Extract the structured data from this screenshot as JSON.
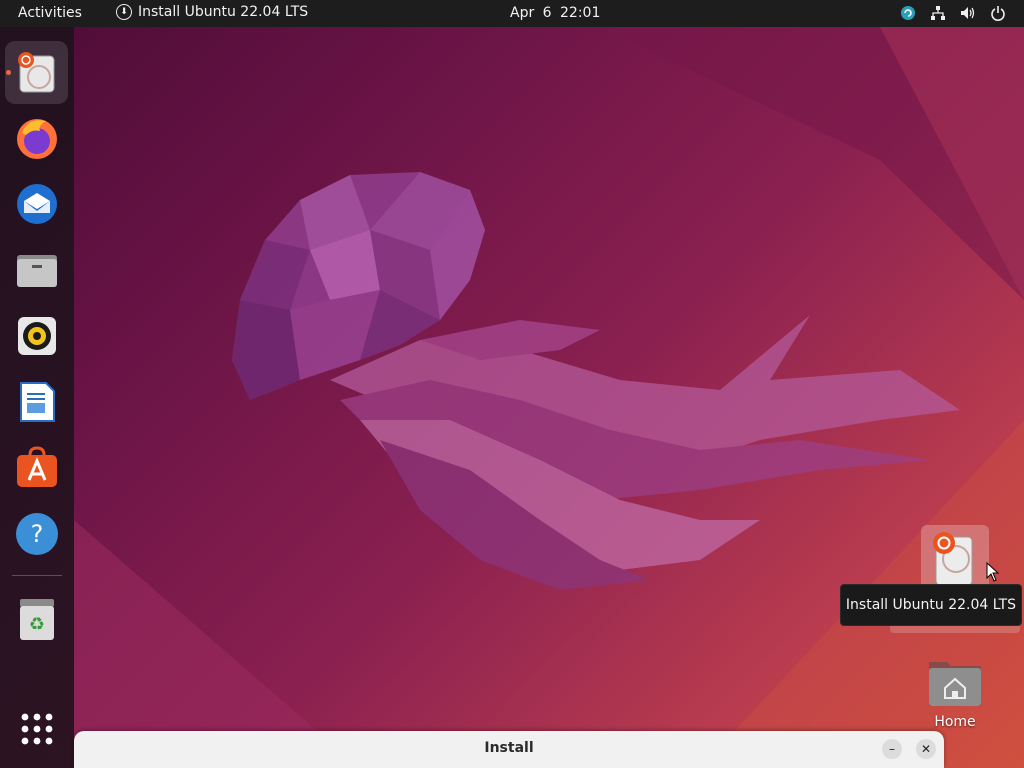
{
  "topbar": {
    "activities_label": "Activities",
    "app_menu_label": "Install Ubuntu 22.04 LTS",
    "clock": "Apr 6  22:01",
    "tray_icons": [
      "update-icon",
      "network-icon",
      "volume-icon",
      "power-icon"
    ]
  },
  "dock": {
    "items": [
      {
        "name": "install-ubuntu",
        "icon": "installer-icon",
        "active": true,
        "running": true
      },
      {
        "name": "firefox",
        "icon": "firefox-icon"
      },
      {
        "name": "thunderbird",
        "icon": "thunderbird-icon"
      },
      {
        "name": "files",
        "icon": "files-icon"
      },
      {
        "name": "rhythmbox",
        "icon": "rhythmbox-icon"
      },
      {
        "name": "libreoffice-writer",
        "icon": "writer-icon"
      },
      {
        "name": "ubuntu-software",
        "icon": "software-icon"
      },
      {
        "name": "help",
        "icon": "help-icon"
      },
      {
        "name": "trash",
        "icon": "trash-icon"
      },
      {
        "name": "show-applications",
        "icon": "app-grid-icon"
      }
    ]
  },
  "desktop": {
    "icons": [
      {
        "name": "install-ubuntu",
        "label": "Install Ubuntu 22.04 LTS",
        "icon": "installer-icon",
        "selected": true
      },
      {
        "name": "home",
        "label": "Home",
        "icon": "home-folder-icon"
      }
    ],
    "tooltip": "Install Ubuntu 22.04 LTS"
  },
  "install_window": {
    "title": "Install",
    "minimize_label": "–",
    "close_label": "✕"
  },
  "colors": {
    "topbar_bg": "#1d1d1d",
    "accent_orange": "#e95420",
    "wallpaper_purple": "#6a1446"
  }
}
